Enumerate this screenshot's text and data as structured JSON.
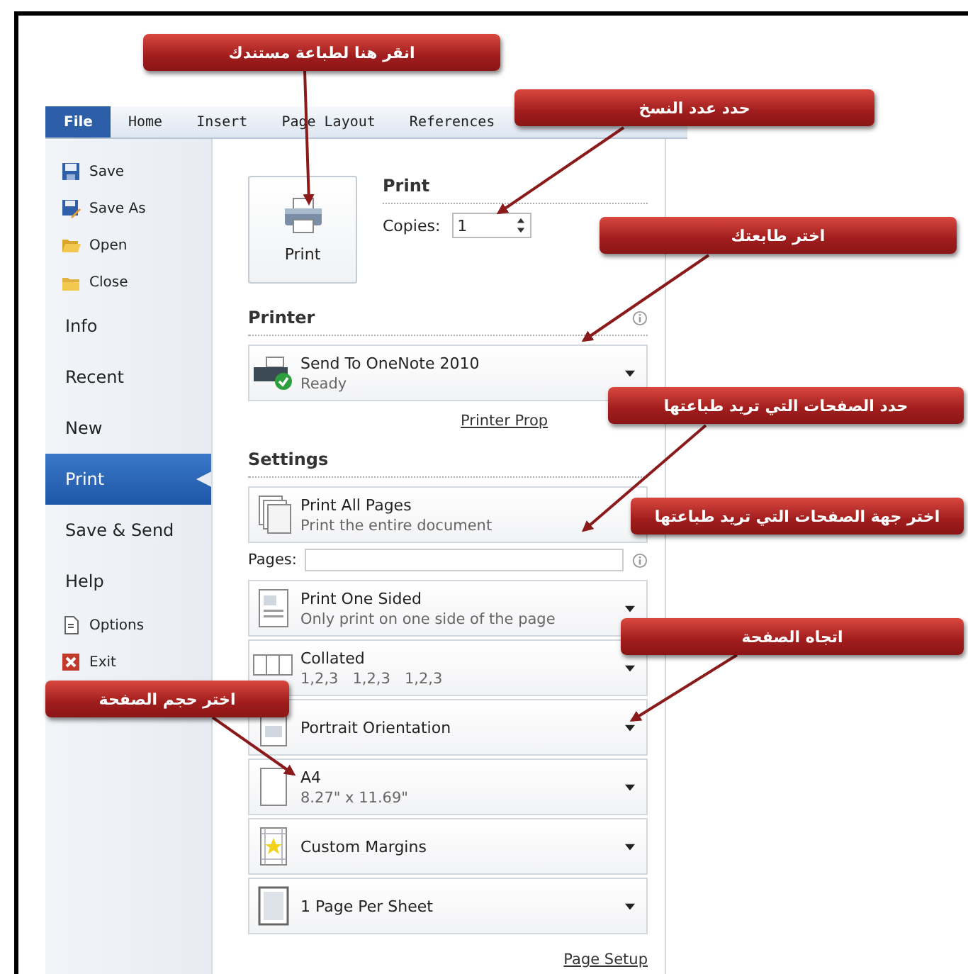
{
  "ribbon_tabs": [
    {
      "label": "File",
      "selected": true
    },
    {
      "label": "Home",
      "selected": false
    },
    {
      "label": "Insert",
      "selected": false
    },
    {
      "label": "Page Layout",
      "selected": false
    },
    {
      "label": "References",
      "selected": false
    }
  ],
  "sidebar": {
    "items": [
      {
        "label": "Save",
        "kind": "command",
        "selected": false
      },
      {
        "label": "Save As",
        "kind": "command",
        "selected": false
      },
      {
        "label": "Open",
        "kind": "command",
        "selected": false
      },
      {
        "label": "Close",
        "kind": "command",
        "selected": false
      },
      {
        "label": "Info",
        "kind": "page",
        "selected": false
      },
      {
        "label": "Recent",
        "kind": "page",
        "selected": false
      },
      {
        "label": "New",
        "kind": "page",
        "selected": false
      },
      {
        "label": "Print",
        "kind": "page",
        "selected": true
      },
      {
        "label": "Save & Send",
        "kind": "page",
        "selected": false
      },
      {
        "label": "Help",
        "kind": "page",
        "selected": false
      },
      {
        "label": "Options",
        "kind": "command",
        "selected": false
      },
      {
        "label": "Exit",
        "kind": "command",
        "selected": false
      }
    ]
  },
  "print": {
    "heading": "Print",
    "button": "Print",
    "copies_label": "Copies:",
    "copies": "1"
  },
  "printer": {
    "heading": "Printer",
    "name": "Send To OneNote 2010",
    "status": "Ready",
    "properties_link": "Printer Prop"
  },
  "settings": {
    "heading": "Settings",
    "pages_label": "Pages:",
    "options": [
      {
        "title": "Print All Pages",
        "subtitle": "Print the entire document",
        "dropdown": false
      },
      {
        "title": "Print One Sided",
        "subtitle": "Only print on one side of the page",
        "dropdown": true
      },
      {
        "title": "Collated",
        "subtitle": "1,2,3   1,2,3   1,2,3",
        "dropdown": true
      },
      {
        "title": "Portrait Orientation",
        "dropdown": true
      },
      {
        "title": "A4",
        "subtitle": "8.27\" x 11.69\"",
        "dropdown": true
      },
      {
        "title": "Custom Margins",
        "dropdown": true
      },
      {
        "title": "1 Page Per Sheet",
        "dropdown": true
      }
    ]
  },
  "page_setup_link": "Page Setup",
  "callouts": [
    {
      "text": "انقر هنا لطباعة مستندك",
      "arrow": true
    },
    {
      "text": "حدد عدد النسخ",
      "arrow": true
    },
    {
      "text": "اختر طابعتك",
      "arrow": true
    },
    {
      "text": "حدد الصفحات التي تريد طباعتها",
      "arrow": true
    },
    {
      "text": "اختر جهة الصفحات التي تريد طباعتها",
      "arrow": false
    },
    {
      "text": "اتجاه الصفحة",
      "arrow": true
    },
    {
      "text": "اختر حجم الصفحة",
      "arrow": true
    }
  ]
}
